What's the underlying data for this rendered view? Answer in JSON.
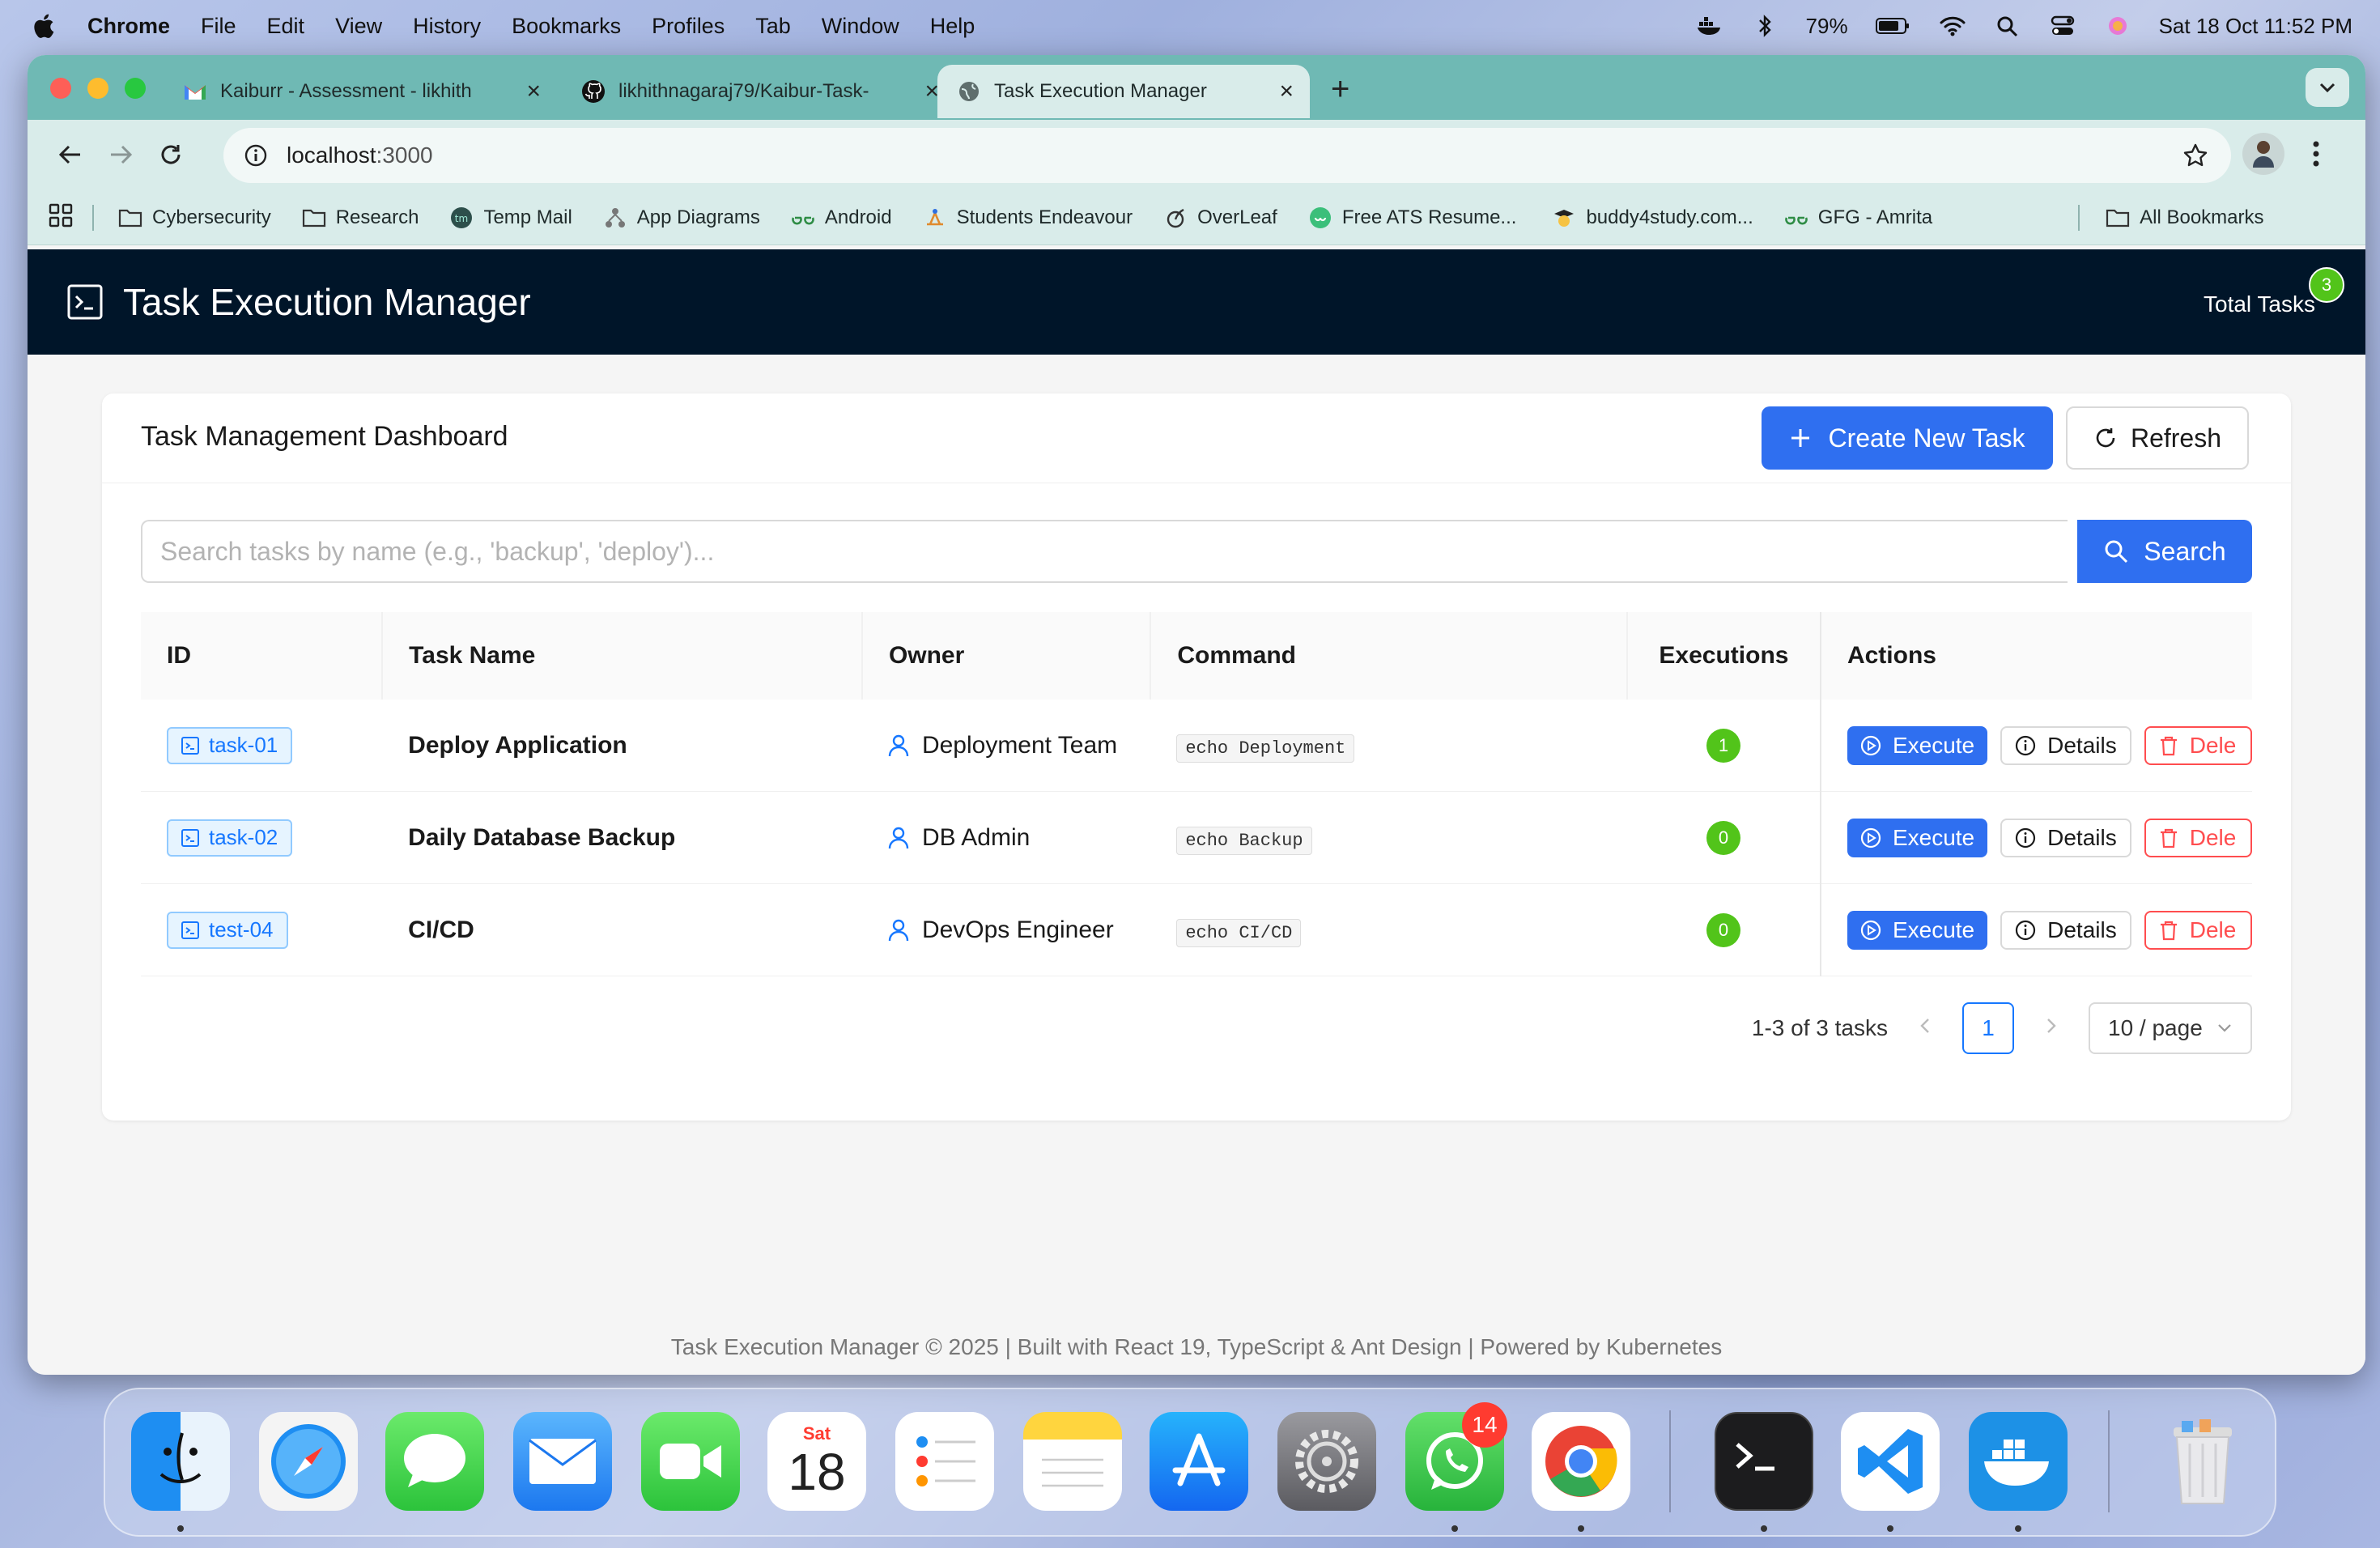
{
  "menubar": {
    "app": "Chrome",
    "items": [
      "File",
      "Edit",
      "View",
      "History",
      "Bookmarks",
      "Profiles",
      "Tab",
      "Window",
      "Help"
    ],
    "battery": "79%",
    "datetime": "Sat 18 Oct  11:52 PM"
  },
  "browser": {
    "tabs": [
      {
        "label": "Kaiburr - Assessment - likhith",
        "icon": "gmail-icon"
      },
      {
        "label": "likhithnagaraj79/Kaibur-Task-",
        "icon": "github-icon"
      },
      {
        "label": "Task Execution Manager",
        "icon": "globe-icon"
      }
    ],
    "url_host": "localhost",
    "url_port": ":3000",
    "bookmarks": [
      {
        "label": "Cybersecurity",
        "icon": "folder-icon"
      },
      {
        "label": "Research",
        "icon": "folder-icon"
      },
      {
        "label": "Temp Mail",
        "icon": "tempmail-icon"
      },
      {
        "label": "App Diagrams",
        "icon": "diagram-icon"
      },
      {
        "label": "Android",
        "icon": "gfg-icon"
      },
      {
        "label": "Students Endeavour",
        "icon": "endeavour-icon"
      },
      {
        "label": "OverLeaf",
        "icon": "overleaf-icon"
      },
      {
        "label": "Free ATS Resume...",
        "icon": "resume-icon"
      },
      {
        "label": "buddy4study.com...",
        "icon": "graduate-icon"
      },
      {
        "label": "GFG - Amrita",
        "icon": "gfg-icon"
      }
    ],
    "all_bookmarks": "All Bookmarks"
  },
  "app": {
    "title": "Task Execution Manager",
    "total_label": "Total Tasks",
    "total_count": "3"
  },
  "dashboard": {
    "title": "Task Management Dashboard",
    "create_label": "Create New Task",
    "refresh_label": "Refresh",
    "search_placeholder": "Search tasks by name (e.g., 'backup', 'deploy')...",
    "search_label": "Search"
  },
  "table": {
    "columns": [
      "ID",
      "Task Name",
      "Owner",
      "Command",
      "Executions",
      "Actions"
    ],
    "rows": [
      {
        "id": "task-01",
        "name": "Deploy Application",
        "owner": "Deployment Team",
        "command": "echo Deployment",
        "executions": "1"
      },
      {
        "id": "task-02",
        "name": "Daily Database Backup",
        "owner": "DB Admin",
        "command": "echo Backup",
        "executions": "0"
      },
      {
        "id": "test-04",
        "name": "CI/CD",
        "owner": "DevOps Engineer",
        "command": "echo CI/CD",
        "executions": "0"
      }
    ],
    "action_execute": "Execute",
    "action_details": "Details",
    "action_delete": "Dele"
  },
  "pagination": {
    "summary": "1-3 of 3 tasks",
    "current_page": "1",
    "page_size": "10 / page"
  },
  "footer": "Task Execution Manager © 2025 | Built with React 19, TypeScript & Ant Design | Powered by Kubernetes",
  "dock": {
    "apps": [
      "Finder",
      "Safari",
      "Messages",
      "Mail",
      "FaceTime",
      "Calendar",
      "Reminders",
      "Notes",
      "App Store",
      "System Settings",
      "WhatsApp",
      "Chrome",
      "Terminal",
      "VS Code",
      "Docker",
      "Trash"
    ],
    "calendar_day": "Sat",
    "calendar_date": "18",
    "whatsapp_badge": "14"
  },
  "colors": {
    "primary": "#2f6ff0",
    "header_bg": "#001529",
    "success": "#52c41a",
    "danger": "#ff4d4f",
    "tab_strip": "#6fb9b4"
  }
}
